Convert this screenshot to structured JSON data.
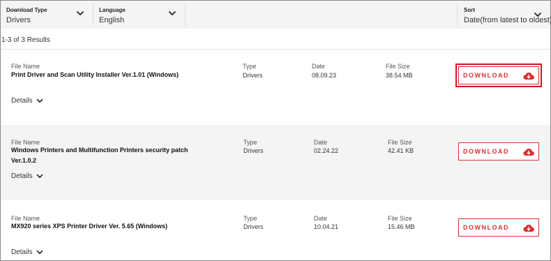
{
  "filters": {
    "download_type": {
      "label": "Download Type",
      "value": "Drivers"
    },
    "language": {
      "label": "Language",
      "value": "English"
    },
    "sort": {
      "label": "Sort",
      "value": "Date(from latest to oldest)"
    }
  },
  "results_text": "1-3 of 3 Results",
  "columns": {
    "file_name": "File Name",
    "type": "Type",
    "date": "Date",
    "file_size": "File Size"
  },
  "rows": [
    {
      "file_name_line1": "Print Driver and Scan Utility Installer Ver.1.01 (Windows)",
      "file_name_line2": "",
      "type": "Drivers",
      "date": "08.09.23",
      "file_size": "38.54 MB"
    },
    {
      "file_name_line1": "Windows Printers and Multifunction Printers security patch",
      "file_name_line2": "Ver.1.0.2",
      "type": "Drivers",
      "date": "02.24.22",
      "file_size": "42.41 KB"
    },
    {
      "file_name_line1": "MX920 series XPS Printer Driver Ver. 5.65 (Windows)",
      "file_name_line2": "",
      "type": "Drivers",
      "date": "10.04.21",
      "file_size": "15.46 MB"
    }
  ],
  "details_label": "Details",
  "download_label": "DOWNLOAD",
  "colors": {
    "accent": "#d72f2f",
    "highlight": "#cc1818",
    "shaded_row": "#f4f4f4"
  },
  "icons": {
    "chevron": "chevron-down-icon",
    "download": "cloud-download-icon"
  }
}
